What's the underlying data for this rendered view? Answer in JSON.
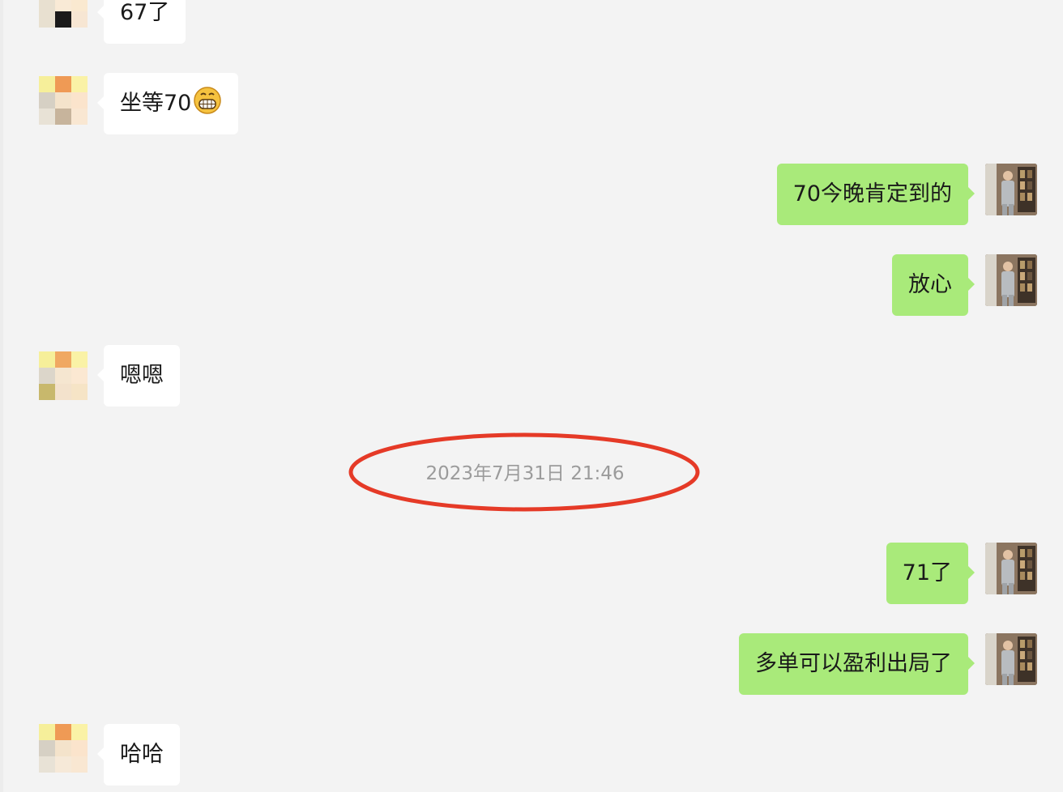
{
  "messages": [
    {
      "side": "in",
      "text": "67了"
    },
    {
      "side": "in",
      "text": "坐等70",
      "emoji": "grinning-face-emoji"
    },
    {
      "side": "out",
      "text": "70今晚肯定到的"
    },
    {
      "side": "out",
      "text": "放心"
    },
    {
      "side": "in",
      "text": "嗯嗯"
    },
    {
      "side": "out",
      "text": "71了"
    },
    {
      "side": "out",
      "text": "多单可以盈利出局了"
    },
    {
      "side": "in",
      "text": "哈哈"
    }
  ],
  "timestamp": "2023年7月31日 21:46",
  "colors": {
    "outgoing_bubble": "#a9ea7a",
    "incoming_bubble": "#ffffff",
    "background": "#f3f3f3",
    "highlight_circle": "#e53a27"
  }
}
